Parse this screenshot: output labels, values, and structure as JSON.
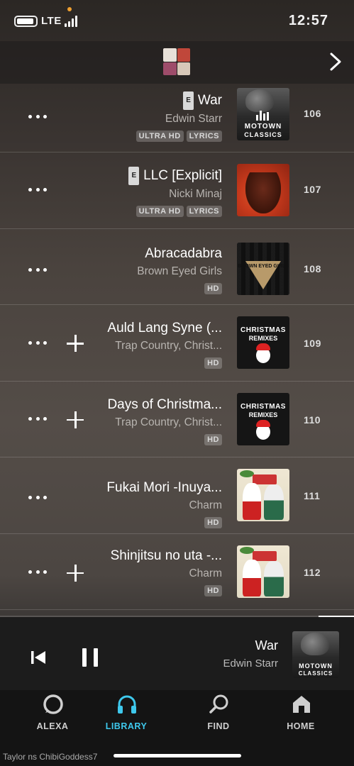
{
  "status_bar": {
    "time": "12:57",
    "network": "LTE"
  },
  "header": {
    "chevron_icon": "chevron-right-icon"
  },
  "tracks": [
    {
      "number": "106",
      "title": "War",
      "explicit": "E",
      "artist": "Edwin Starr",
      "badges": [
        "ULTRA HD",
        "LYRICS"
      ],
      "has_add": false,
      "art": "motown-classics"
    },
    {
      "number": "107",
      "title": "LLC [Explicit]",
      "explicit": "E",
      "artist": "Nicki Minaj",
      "badges": [
        "ULTRA HD",
        "LYRICS"
      ],
      "has_add": false,
      "art": "llc"
    },
    {
      "number": "108",
      "title": "Abracadabra",
      "explicit": "",
      "artist": "Brown Eyed Girls",
      "badges": [
        "HD"
      ],
      "has_add": false,
      "art": "brown-eyed-girls"
    },
    {
      "number": "109",
      "title": "Auld Lang Syne (...",
      "explicit": "",
      "artist": "Trap Country, Christ...",
      "badges": [
        "HD"
      ],
      "has_add": true,
      "art": "christmas-remixes"
    },
    {
      "number": "110",
      "title": "Days of Christma...",
      "explicit": "",
      "artist": "Trap Country, Christ...",
      "badges": [
        "HD"
      ],
      "has_add": true,
      "art": "christmas-remixes"
    },
    {
      "number": "111",
      "title": "Fukai Mori -Inuya...",
      "explicit": "",
      "artist": "Charm",
      "badges": [
        "HD"
      ],
      "has_add": false,
      "art": "charm"
    },
    {
      "number": "112",
      "title": "Shinjitsu no uta -...",
      "explicit": "",
      "artist": "Charm",
      "badges": [
        "HD"
      ],
      "has_add": true,
      "art": "charm"
    }
  ],
  "art_text": {
    "motown_line1": "MOTOWN",
    "motown_line2": "CLASSICS",
    "christmas_line1": "CHRISTMAS",
    "christmas_line2": "REMIXES",
    "beg_text": "BROWN EYED GIRLS"
  },
  "now_playing": {
    "title": "War",
    "artist": "Edwin Starr",
    "progress": 0.1
  },
  "tabs": [
    {
      "label": "HOME",
      "icon": "home-icon",
      "active": false
    },
    {
      "label": "FIND",
      "icon": "search-icon",
      "active": false
    },
    {
      "label": "LIBRARY",
      "icon": "headphones-icon",
      "active": true
    },
    {
      "label": "ALEXA",
      "icon": "alexa-icon",
      "active": false
    }
  ],
  "watermark": "Taylor ns ChibiGoddess7",
  "colors": {
    "accent": "#3ec8ec",
    "background": "#4a433e"
  }
}
